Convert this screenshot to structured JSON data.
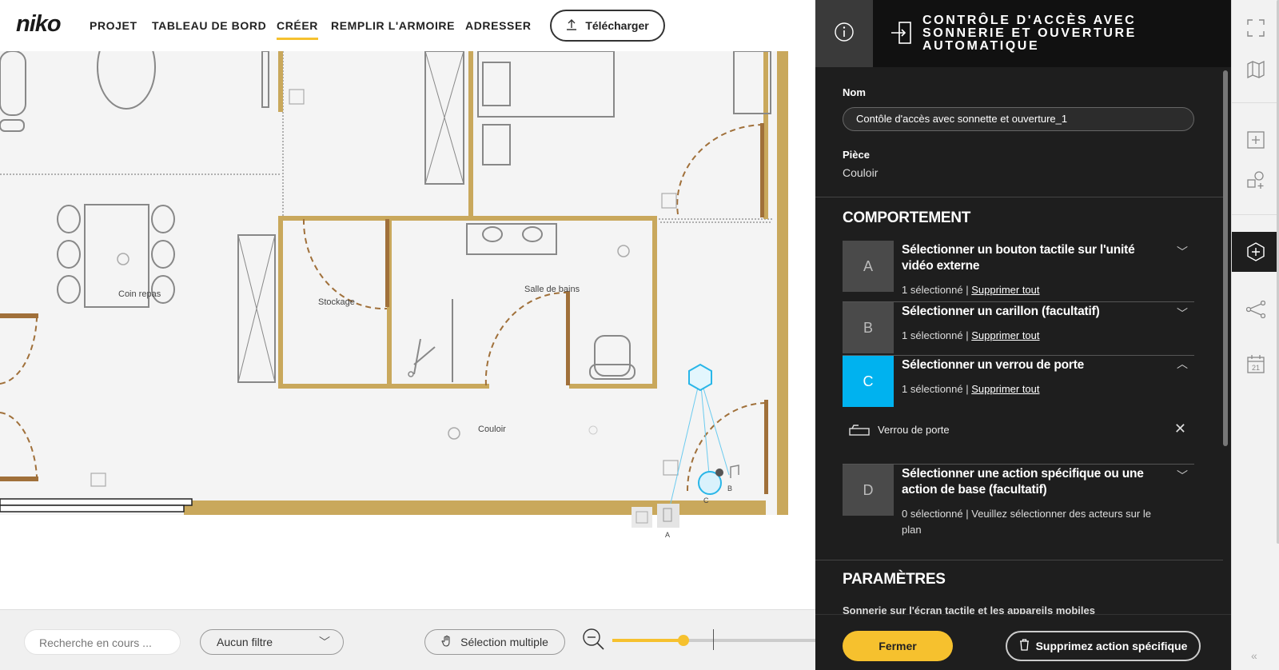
{
  "app": {
    "logo": "niko"
  },
  "nav": {
    "items": [
      {
        "label": "PROJET",
        "active": false
      },
      {
        "label": "TABLEAU DE BORD",
        "active": false
      },
      {
        "label": "CRÉER",
        "active": true
      },
      {
        "label": "REMPLIR L'ARMOIRE",
        "active": false
      },
      {
        "label": "ADRESSER",
        "active": false
      }
    ],
    "upload_label": "Télécharger"
  },
  "plan": {
    "rooms": {
      "dining": "Coin repas",
      "storage": "Stockage",
      "bathroom": "Salle de bains",
      "corridor": "Couloir"
    },
    "device_labels": {
      "a": "A",
      "b": "B",
      "c": "C"
    }
  },
  "toolbar": {
    "search_placeholder": "Recherche en cours ...",
    "filter_value": "Aucun filtre",
    "multiselect_label": "Sélection multiple",
    "zoom_level": 0.35
  },
  "panel": {
    "title": "CONTRÔLE D'ACCÈS AVEC SONNERIE ET OUVERTURE AUTOMATIQUE",
    "nom_label": "Nom",
    "nom_value": "Contôle d'accès avec sonnette et ouverture_1",
    "piece_label": "Pièce",
    "piece_value": "Couloir",
    "behaviour_title": "COMPORTEMENT",
    "steps": [
      {
        "letter": "A",
        "title": "Sélectionner un bouton tactile sur l'unité vidéo externe",
        "count": "1 sélectionné",
        "action": "Supprimer tout",
        "expanded": false
      },
      {
        "letter": "B",
        "title": "Sélectionner un carillon (facultatif)",
        "count": "1 sélectionné",
        "action": "Supprimer tout",
        "expanded": false
      },
      {
        "letter": "C",
        "title": "Sélectionner un verrou de porte",
        "count": "1 sélectionné",
        "action": "Supprimer tout",
        "expanded": true
      },
      {
        "letter": "D",
        "title": "Sélectionner une action spécifique ou une action de base (facultatif)",
        "count": "0 sélectionné",
        "action": "Veuillez sélectionner des acteurs sur le plan",
        "expanded": false
      }
    ],
    "lock_item": "Verrou de porte",
    "params_title": "PARAMÈTRES",
    "params_sub": "Sonnerie sur l'écran tactile et les appareils mobiles",
    "close_label": "Fermer",
    "delete_label": "Supprimez action spécifique"
  },
  "colors": {
    "accent": "#f6c12e",
    "active_step": "#00b2ef",
    "panel_bg": "#1e1e1e",
    "wall": "#c9a85c"
  },
  "rail": {
    "icons": [
      "fullscreen-icon",
      "map-icon",
      "add-icon",
      "add-shape-icon",
      "add-circle-icon",
      "share-icon",
      "calendar-icon"
    ],
    "calendar_day": "21"
  }
}
